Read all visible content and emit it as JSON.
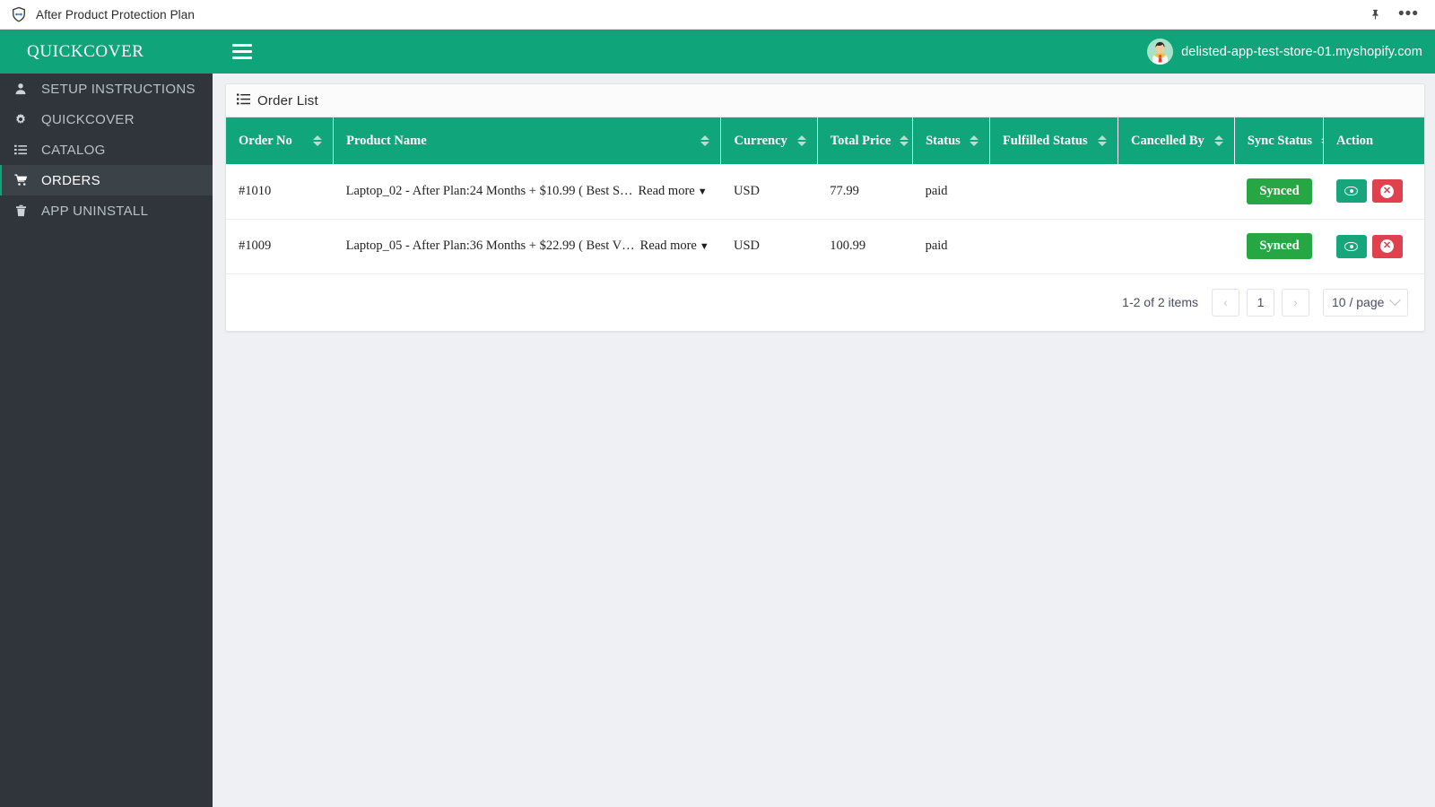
{
  "titlebar": {
    "app_title": "After Product Protection Plan",
    "shield_icon": "shield-icon",
    "pin_icon": "pin-icon",
    "more_icon": "ellipsis-icon",
    "more_glyph": "•••"
  },
  "sidebar": {
    "brand": "QUICKCOVER",
    "items": [
      {
        "label": "SETUP INSTRUCTIONS",
        "icon": "user-icon",
        "glyph": "👤",
        "active": false
      },
      {
        "label": "QUICKCOVER",
        "icon": "gear-icon",
        "glyph": "⚙",
        "active": false
      },
      {
        "label": "CATALOG",
        "icon": "list-icon",
        "glyph": "☰",
        "active": false
      },
      {
        "label": "ORDERS",
        "icon": "cart-icon",
        "glyph": "🛒",
        "active": true
      },
      {
        "label": "APP UNINSTALL",
        "icon": "trash-icon",
        "glyph": "🗑",
        "active": false
      }
    ]
  },
  "topbar": {
    "menu_toggle_icon": "hamburger-icon",
    "store_name": "delisted-app-test-store-01.myshopify.com",
    "avatar_icon": "user-avatar"
  },
  "card": {
    "header_icon": "list-icon",
    "title": "Order List"
  },
  "table": {
    "columns": [
      {
        "label": "Order No",
        "sortable": true
      },
      {
        "label": "Product Name",
        "sortable": true
      },
      {
        "label": "Currency",
        "sortable": true
      },
      {
        "label": "Total Price",
        "sortable": true
      },
      {
        "label": "Status",
        "sortable": true
      },
      {
        "label": "Fulfilled Status",
        "sortable": true
      },
      {
        "label": "Cancelled By",
        "sortable": true
      },
      {
        "label": "Sync Status",
        "sortable": true
      },
      {
        "label": "Action",
        "sortable": false
      }
    ],
    "rows": [
      {
        "order_no": "#1010",
        "product_name": "Laptop_02 - After Plan:24 Months + $10.99 ( Best S…",
        "read_more": "Read more",
        "read_more_caret": "▼",
        "currency": "USD",
        "total_price": "77.99",
        "status": "paid",
        "fulfilled_status": "",
        "cancelled_by": "",
        "sync_status": "Synced",
        "action_view_icon": "eye-icon",
        "action_cancel_icon": "circle-x-icon",
        "action_cancel_glyph": "✕"
      },
      {
        "order_no": "#1009",
        "product_name": "Laptop_05 - After Plan:36 Months + $22.99 ( Best V…",
        "read_more": "Read more",
        "read_more_caret": "▼",
        "currency": "USD",
        "total_price": "100.99",
        "status": "paid",
        "fulfilled_status": "",
        "cancelled_by": "",
        "sync_status": "Synced",
        "action_view_icon": "eye-icon",
        "action_cancel_icon": "circle-x-icon",
        "action_cancel_glyph": "✕"
      }
    ]
  },
  "pagination": {
    "info": "1-2 of 2 items",
    "prev_glyph": "‹",
    "next_glyph": "›",
    "current_page": "1",
    "page_size": "10 / page"
  },
  "colors": {
    "brand_green": "#0fa47a",
    "header_green": "#10a57a",
    "sidebar_dark": "#2f353a",
    "sidebar_active": "#3b4248",
    "badge_green": "#26a744",
    "danger_red": "#e0414f",
    "page_bg": "#eff0f4"
  }
}
